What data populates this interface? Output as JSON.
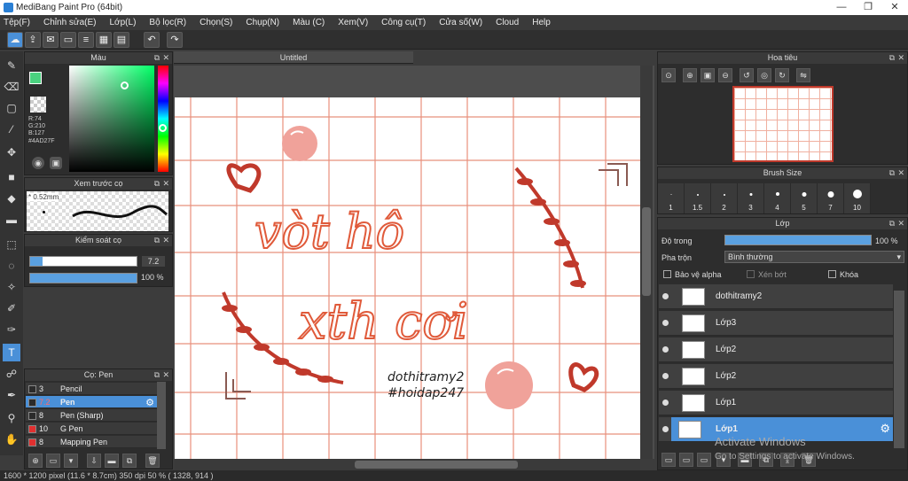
{
  "window": {
    "title": "MediBang Paint Pro (64bit)",
    "minimize": "—",
    "maximize": "❐",
    "close": "✕"
  },
  "menu": [
    "Tệp(F)",
    "Chỉnh sửa(E)",
    "Lớp(L)",
    "Bộ lọc(R)",
    "Chọn(S)",
    "Chụp(N)",
    "Màu (C)",
    "Xem(V)",
    "Công cụ(T)",
    "Cửa số(W)",
    "Cloud",
    "Help"
  ],
  "toolbar_icons": [
    "cloud-icon",
    "share-icon",
    "comment-icon",
    "page-icon",
    "page-list-icon",
    "layout-icon",
    "grid-icon",
    "undo-icon",
    "redo-icon"
  ],
  "color_panel": {
    "title": "Màu",
    "r": "R:74",
    "g": "G:210",
    "b": "B:127",
    "hex": "#4AD27F",
    "main_color": "#4AD27F"
  },
  "brush_preview": {
    "title": "Xem trước cọ",
    "size": "0.52mm"
  },
  "brush_control": {
    "title": "Kiểm soát cọ",
    "size_value": "7.2",
    "opacity_value": "100 %"
  },
  "brush_panel": {
    "title": "Cọ: Pen",
    "items": [
      {
        "size": "3",
        "name": "Pencil",
        "color": "#2b2b2b",
        "selected": false
      },
      {
        "size": "7.2",
        "name": "Pen",
        "color": "#2b2b2b",
        "selected": true
      },
      {
        "size": "8",
        "name": "Pen (Sharp)",
        "color": "#2b2b2b",
        "selected": false
      },
      {
        "size": "10",
        "name": "G Pen",
        "color": "#e03030",
        "selected": false
      },
      {
        "size": "8",
        "name": "Mapping Pen",
        "color": "#e03030",
        "selected": false
      }
    ]
  },
  "document": {
    "tab": "Untitled"
  },
  "artwork": {
    "line1": "vòt hô",
    "line2": "xth cơi",
    "credit1": "dothitramy2",
    "credit2": "#hoidap247"
  },
  "navigator": {
    "title": "Hoa tiêu"
  },
  "brush_size": {
    "title": "Brush Size",
    "sizes": [
      "1",
      "1.5",
      "2",
      "3",
      "4",
      "5",
      "7",
      "10"
    ]
  },
  "layer_panel": {
    "title": "Lớp",
    "opacity_label": "Độ trong",
    "opacity_value": "100 %",
    "blend_label": "Pha trộn",
    "blend_value": "Bình thường",
    "protect_alpha": "Bảo vệ alpha",
    "clipping": "Xén bớt",
    "lock": "Khóa",
    "layers": [
      {
        "name": "dothitramy2",
        "selected": false
      },
      {
        "name": "Lớp3",
        "selected": false
      },
      {
        "name": "Lớp2",
        "selected": false
      },
      {
        "name": "Lớp2",
        "selected": false
      },
      {
        "name": "Lớp1",
        "selected": false
      },
      {
        "name": "Lớp1",
        "selected": true
      }
    ]
  },
  "watermark": {
    "line1": "Activate Windows",
    "line2": "Go to Settings to activate Windows."
  },
  "status": "1600 * 1200 pixel   (11.6 * 8.7cm)   350 dpi   50 %   ( 1328, 914 )"
}
